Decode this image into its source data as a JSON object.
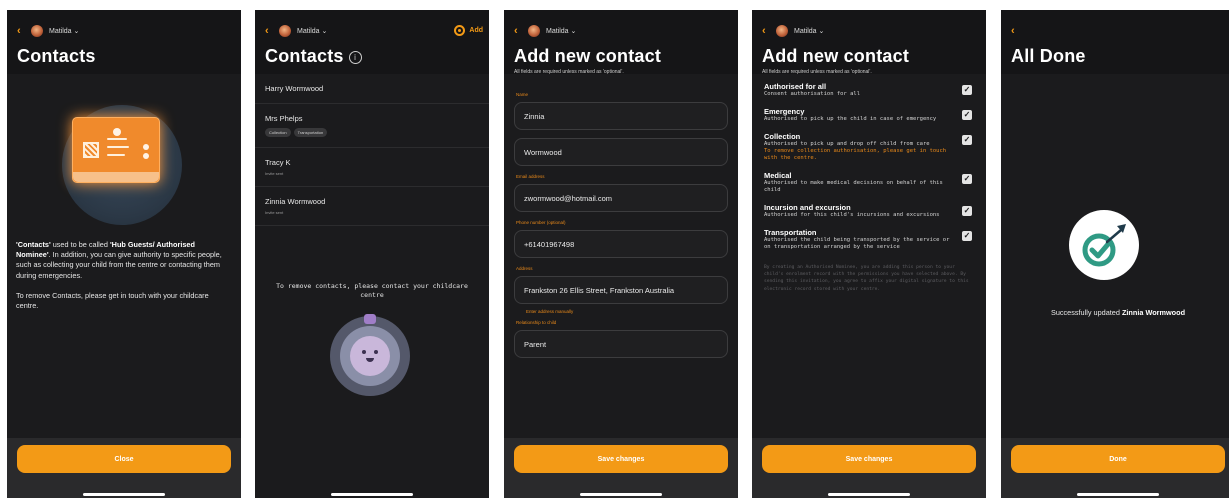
{
  "colors": {
    "accent": "#f39a16",
    "background": "#1b1b1d",
    "header": "#151517",
    "check": "#2f9a84"
  },
  "common": {
    "child_name": "Matilda",
    "back_icon": "chevron-left-icon"
  },
  "screen1": {
    "title": "Contacts",
    "body_p1_start": "'Contacts'",
    "body_p1_mid": " used to be called ",
    "body_p1_bold": "'Hub Guests/ Authorised Nominee'",
    "body_p1_end": ". In addition, you can give authority to specific people, such as collecting your child from the centre or contacting them during emergencies.",
    "body_p2": "To remove Contacts, please get in touch with your childcare centre.",
    "close_label": "Close"
  },
  "screen2": {
    "title": "Contacts",
    "add_label": "Add",
    "contacts": [
      {
        "name": "Harry Wormwood",
        "status": "",
        "tags": []
      },
      {
        "name": "Mrs Phelps",
        "status": "",
        "tags": [
          "Collection",
          "Transportation"
        ]
      },
      {
        "name": "Tracy K",
        "status": "Invite sent",
        "tags": []
      },
      {
        "name": "Zinnia Wormwood",
        "status": "Invite sent",
        "tags": []
      }
    ],
    "remove_note": "To remove contacts, please contact your childcare centre"
  },
  "screen3": {
    "title": "Add new contact",
    "subtitle": "All fields are required unless marked as 'optional'.",
    "name_label": "Name",
    "first_name": "Zinnia",
    "last_name": "Wormwood",
    "email_label": "Email address",
    "email": "zwormwood@hotmail.com",
    "phone_label": "Phone number (optional)",
    "phone": "+61401967498",
    "address_label": "Address",
    "address": "Frankston 26 Ellis Street, Frankston Australia",
    "manual_link": "Enter address manually",
    "relationship_label": "Relationship to child",
    "relationship": "Parent",
    "save_label": "Save changes"
  },
  "screen4": {
    "title": "Add new contact",
    "subtitle": "All fields are required unless marked as 'optional'.",
    "permissions": [
      {
        "title": "Authorised for all",
        "desc": "Consent authorisation for all",
        "warning": "",
        "checked": true
      },
      {
        "title": "Emergency",
        "desc": "Authorised to pick up the child in case of emergency",
        "warning": "",
        "checked": true
      },
      {
        "title": "Collection",
        "desc": "Authorised to pick up and drop off child from care",
        "warning": "To remove collection authorisation, please get in touch with the centre.",
        "checked": true
      },
      {
        "title": "Medical",
        "desc": "Authorised to make medical decisions on behalf of this child",
        "warning": "",
        "checked": true
      },
      {
        "title": "Incursion and excursion",
        "desc": "Authorised for this child's incursions and excursions",
        "warning": "",
        "checked": true
      },
      {
        "title": "Transportation",
        "desc": "Authorised the child being transported by the service or on transportation arranged by the service",
        "warning": "",
        "checked": true
      }
    ],
    "legal": "By creating an Authorised Nominee, you are adding this person to your child's enrolment record with the permissions you have selected above. By sending this invitation, you agree to affix your digital signature to this electronic record stored with your centre.",
    "save_label": "Save changes"
  },
  "screen5": {
    "title": "All Done",
    "success_prefix": "Successfully updated ",
    "success_name": "Zinnia Wormwood",
    "done_label": "Done"
  }
}
